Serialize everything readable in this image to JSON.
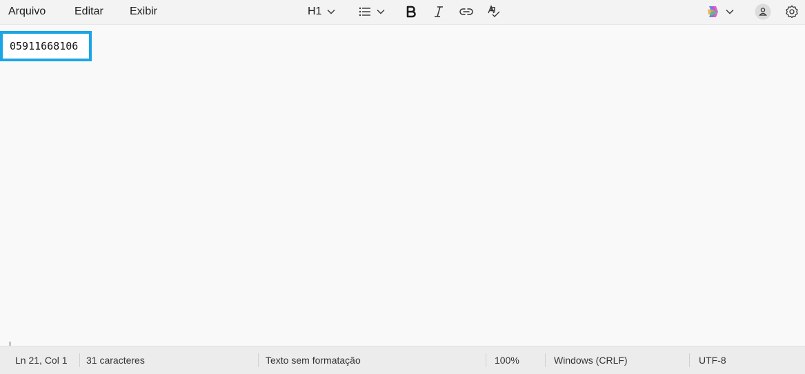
{
  "menu": {
    "file": "Arquivo",
    "edit": "Editar",
    "view": "Exibir"
  },
  "toolbar": {
    "heading_label": "H1",
    "icons": [
      "chevron-down-icon",
      "list-icon",
      "bold-icon",
      "italic-icon",
      "link-icon",
      "spellcheck-icon",
      "copilot-icon",
      "account-icon",
      "gear-icon"
    ]
  },
  "document": {
    "text": "05911668106"
  },
  "status": {
    "position": "Ln 21, Col 1",
    "characters": "31 caracteres",
    "format": "Texto sem formatação",
    "zoom": "100%",
    "line_endings": "Windows (CRLF)",
    "encoding": "UTF-8"
  },
  "colors": {
    "highlight": "#1aa6e6",
    "toolbar_bg": "#f3f3f3",
    "editor_bg": "#f9f9fa"
  }
}
